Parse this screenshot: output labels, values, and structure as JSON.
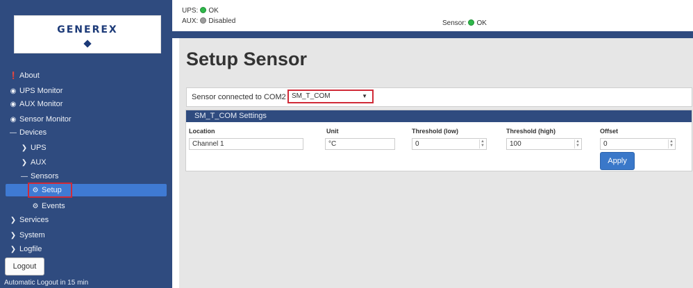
{
  "sidebar": {
    "logo": "GENEREX",
    "nav": {
      "about": "About",
      "ups_monitor": "UPS Monitor",
      "aux_monitor": "AUX Monitor",
      "sensor_monitor": "Sensor Monitor",
      "devices": "Devices",
      "ups": "UPS",
      "aux": "AUX",
      "sensors": "Sensors",
      "setup": "Setup",
      "events": "Events",
      "services": "Services",
      "system": "System",
      "logfile": "Logfile"
    },
    "logout_label": "Logout",
    "auto_logout": "Automatic Logout in 15 min"
  },
  "status": {
    "ups_label": "UPS:",
    "ups_value": "OK",
    "aux_label": "AUX:",
    "aux_value": "Disabled",
    "sensor_label": "Sensor:",
    "sensor_value": "OK"
  },
  "main": {
    "title": "Setup Sensor",
    "sensor_connected_label": "Sensor connected to COM2",
    "sensor_selected": "SM_T_COM",
    "panel_title": "SM_T_COM Settings",
    "columns": {
      "location": "Location",
      "unit": "Unit",
      "threshold_low": "Threshold (low)",
      "threshold_high": "Threshold (high)",
      "offset": "Offset"
    },
    "values": {
      "location": "Channel 1",
      "unit": "°C",
      "threshold_low": "0",
      "threshold_high": "100",
      "offset": "0"
    },
    "apply_label": "Apply"
  },
  "colors": {
    "nav_blue": "#2f4b7f",
    "active_blue": "#3f7ad3",
    "highlight_red": "#d02a37",
    "ok_green": "#2fb84a"
  }
}
